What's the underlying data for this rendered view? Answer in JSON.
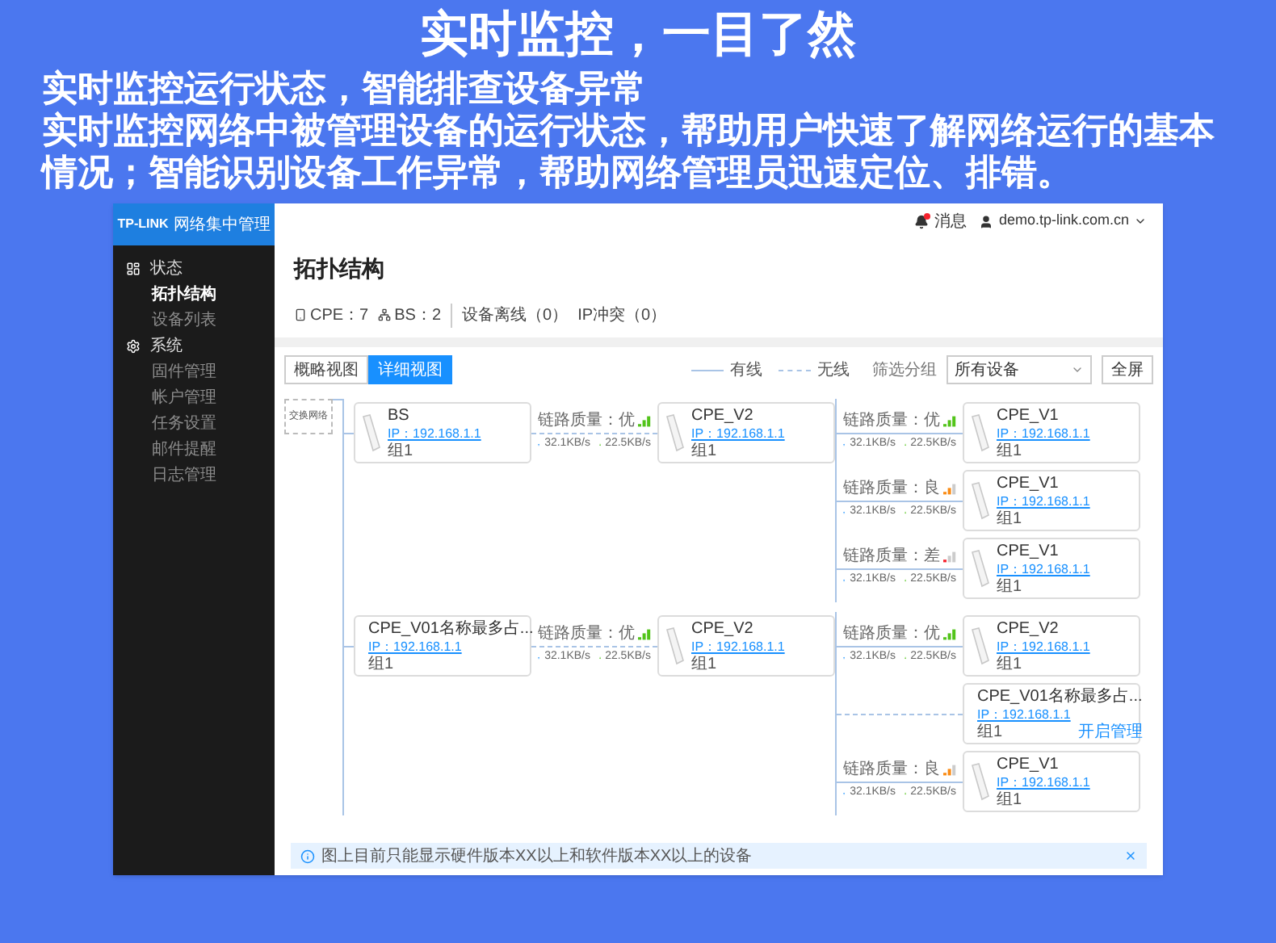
{
  "banner": {
    "title": "实时监控，一目了然",
    "subtitle": "实时监控运行状态，智能排查设备异常",
    "description": "实时监控网络中被管理设备的运行状态，帮助用户快速了解网络运行的基本情况；智能识别设备工作异常，帮助网络管理员迅速定位、排错。"
  },
  "sidebar": {
    "brand": "TP-LINK",
    "product": "网络集中管理",
    "items": [
      {
        "label": "状态",
        "kind": "section"
      },
      {
        "label": "拓扑结构",
        "kind": "item",
        "selected": true
      },
      {
        "label": "设备列表",
        "kind": "item",
        "selected": false
      },
      {
        "label": "系统",
        "kind": "section"
      },
      {
        "label": "固件管理",
        "kind": "item",
        "selected": false
      },
      {
        "label": "帐户管理",
        "kind": "item",
        "selected": false
      },
      {
        "label": "任务设置",
        "kind": "item",
        "selected": false
      },
      {
        "label": "邮件提醒",
        "kind": "item",
        "selected": false
      },
      {
        "label": "日志管理",
        "kind": "item",
        "selected": false
      }
    ]
  },
  "topbar": {
    "messages": "消息",
    "unread": true,
    "user": "demo.tp-link.com.cn"
  },
  "page": {
    "title": "拓扑结构",
    "stats": [
      {
        "label": "CPE：7",
        "kind": "cpe"
      },
      {
        "label": "BS：2",
        "kind": "bs"
      },
      {
        "label": "设备离线（0）",
        "kind": "plain"
      },
      {
        "label": "IP冲突（0）",
        "kind": "plain"
      }
    ]
  },
  "view_tabs": [
    {
      "label": "概略视图",
      "selected": false
    },
    {
      "label": "详细视图",
      "selected": true
    }
  ],
  "legend": [
    {
      "label": "有线",
      "kind": "wired"
    },
    {
      "label": "无线",
      "kind": "wireless"
    }
  ],
  "filter": {
    "label": "筛选分组",
    "value": "所有设备"
  },
  "fullscreen_button": "全屏",
  "topology": {
    "root": "交换网络",
    "groups": [
      {
        "device": {
          "name": "BS",
          "ip": "IP：192.168.1.1",
          "group": "组1"
        },
        "link": {
          "wired": false,
          "quality": "链路质量：优",
          "kind": "good",
          "color": "#52c41a",
          "up": "32.1KB/s",
          "down": "22.5KB/s"
        },
        "relay": {
          "name": "CPE_V2",
          "ip": "IP：192.168.1.1",
          "group": "组1"
        },
        "children": [
          {
            "link": {
              "wired": true,
              "quality": "链路质量：优",
              "kind": "good",
              "color": "#52c41a",
              "up": "32.1KB/s",
              "down": "22.5KB/s"
            },
            "device": {
              "name": "CPE_V1",
              "ip": "IP：192.168.1.1",
              "group": "组1"
            }
          },
          {
            "link": {
              "wired": true,
              "quality": "链路质量：良",
              "kind": "fair",
              "color": "#fa8c16",
              "up": "32.1KB/s",
              "down": "22.5KB/s"
            },
            "device": {
              "name": "CPE_V1",
              "ip": "IP：192.168.1.1",
              "group": "组1"
            }
          },
          {
            "link": {
              "wired": true,
              "quality": "链路质量：差",
              "kind": "poor",
              "color": "#f5222d",
              "up": "32.1KB/s",
              "down": "22.5KB/s"
            },
            "device": {
              "name": "CPE_V1",
              "ip": "IP：192.168.1.1",
              "group": "组1"
            }
          }
        ]
      },
      {
        "device": {
          "name": "CPE_V01名称最多占...",
          "ip": "IP：192.168.1.1",
          "group": "组1"
        },
        "link": {
          "wired": false,
          "quality": "链路质量：优",
          "kind": "good",
          "color": "#52c41a",
          "up": "32.1KB/s",
          "down": "22.5KB/s"
        },
        "relay": {
          "name": "CPE_V2",
          "ip": "IP：192.168.1.1",
          "group": "组1"
        },
        "children": [
          {
            "link": {
              "wired": true,
              "quality": "链路质量：优",
              "kind": "good",
              "color": "#52c41a",
              "up": "32.1KB/s",
              "down": "22.5KB/s"
            },
            "device": {
              "name": "CPE_V2",
              "ip": "IP：192.168.1.1",
              "group": "组1"
            }
          },
          {
            "link": {
              "wired": false
            },
            "device": {
              "name": "CPE_V01名称最多占...",
              "ip": "IP：192.168.1.1",
              "group": "组1",
              "action": "开启管理"
            }
          },
          {
            "link": {
              "wired": true,
              "quality": "链路质量：良",
              "kind": "fair",
              "color": "#fa8c16",
              "up": "32.1KB/s",
              "down": "22.5KB/s"
            },
            "device": {
              "name": "CPE_V1",
              "ip": "IP：192.168.1.1",
              "group": "组1"
            }
          }
        ]
      }
    ]
  },
  "notice": {
    "text": "图上目前只能显示硬件版本XX以上和软件版本XX以上的设备"
  }
}
